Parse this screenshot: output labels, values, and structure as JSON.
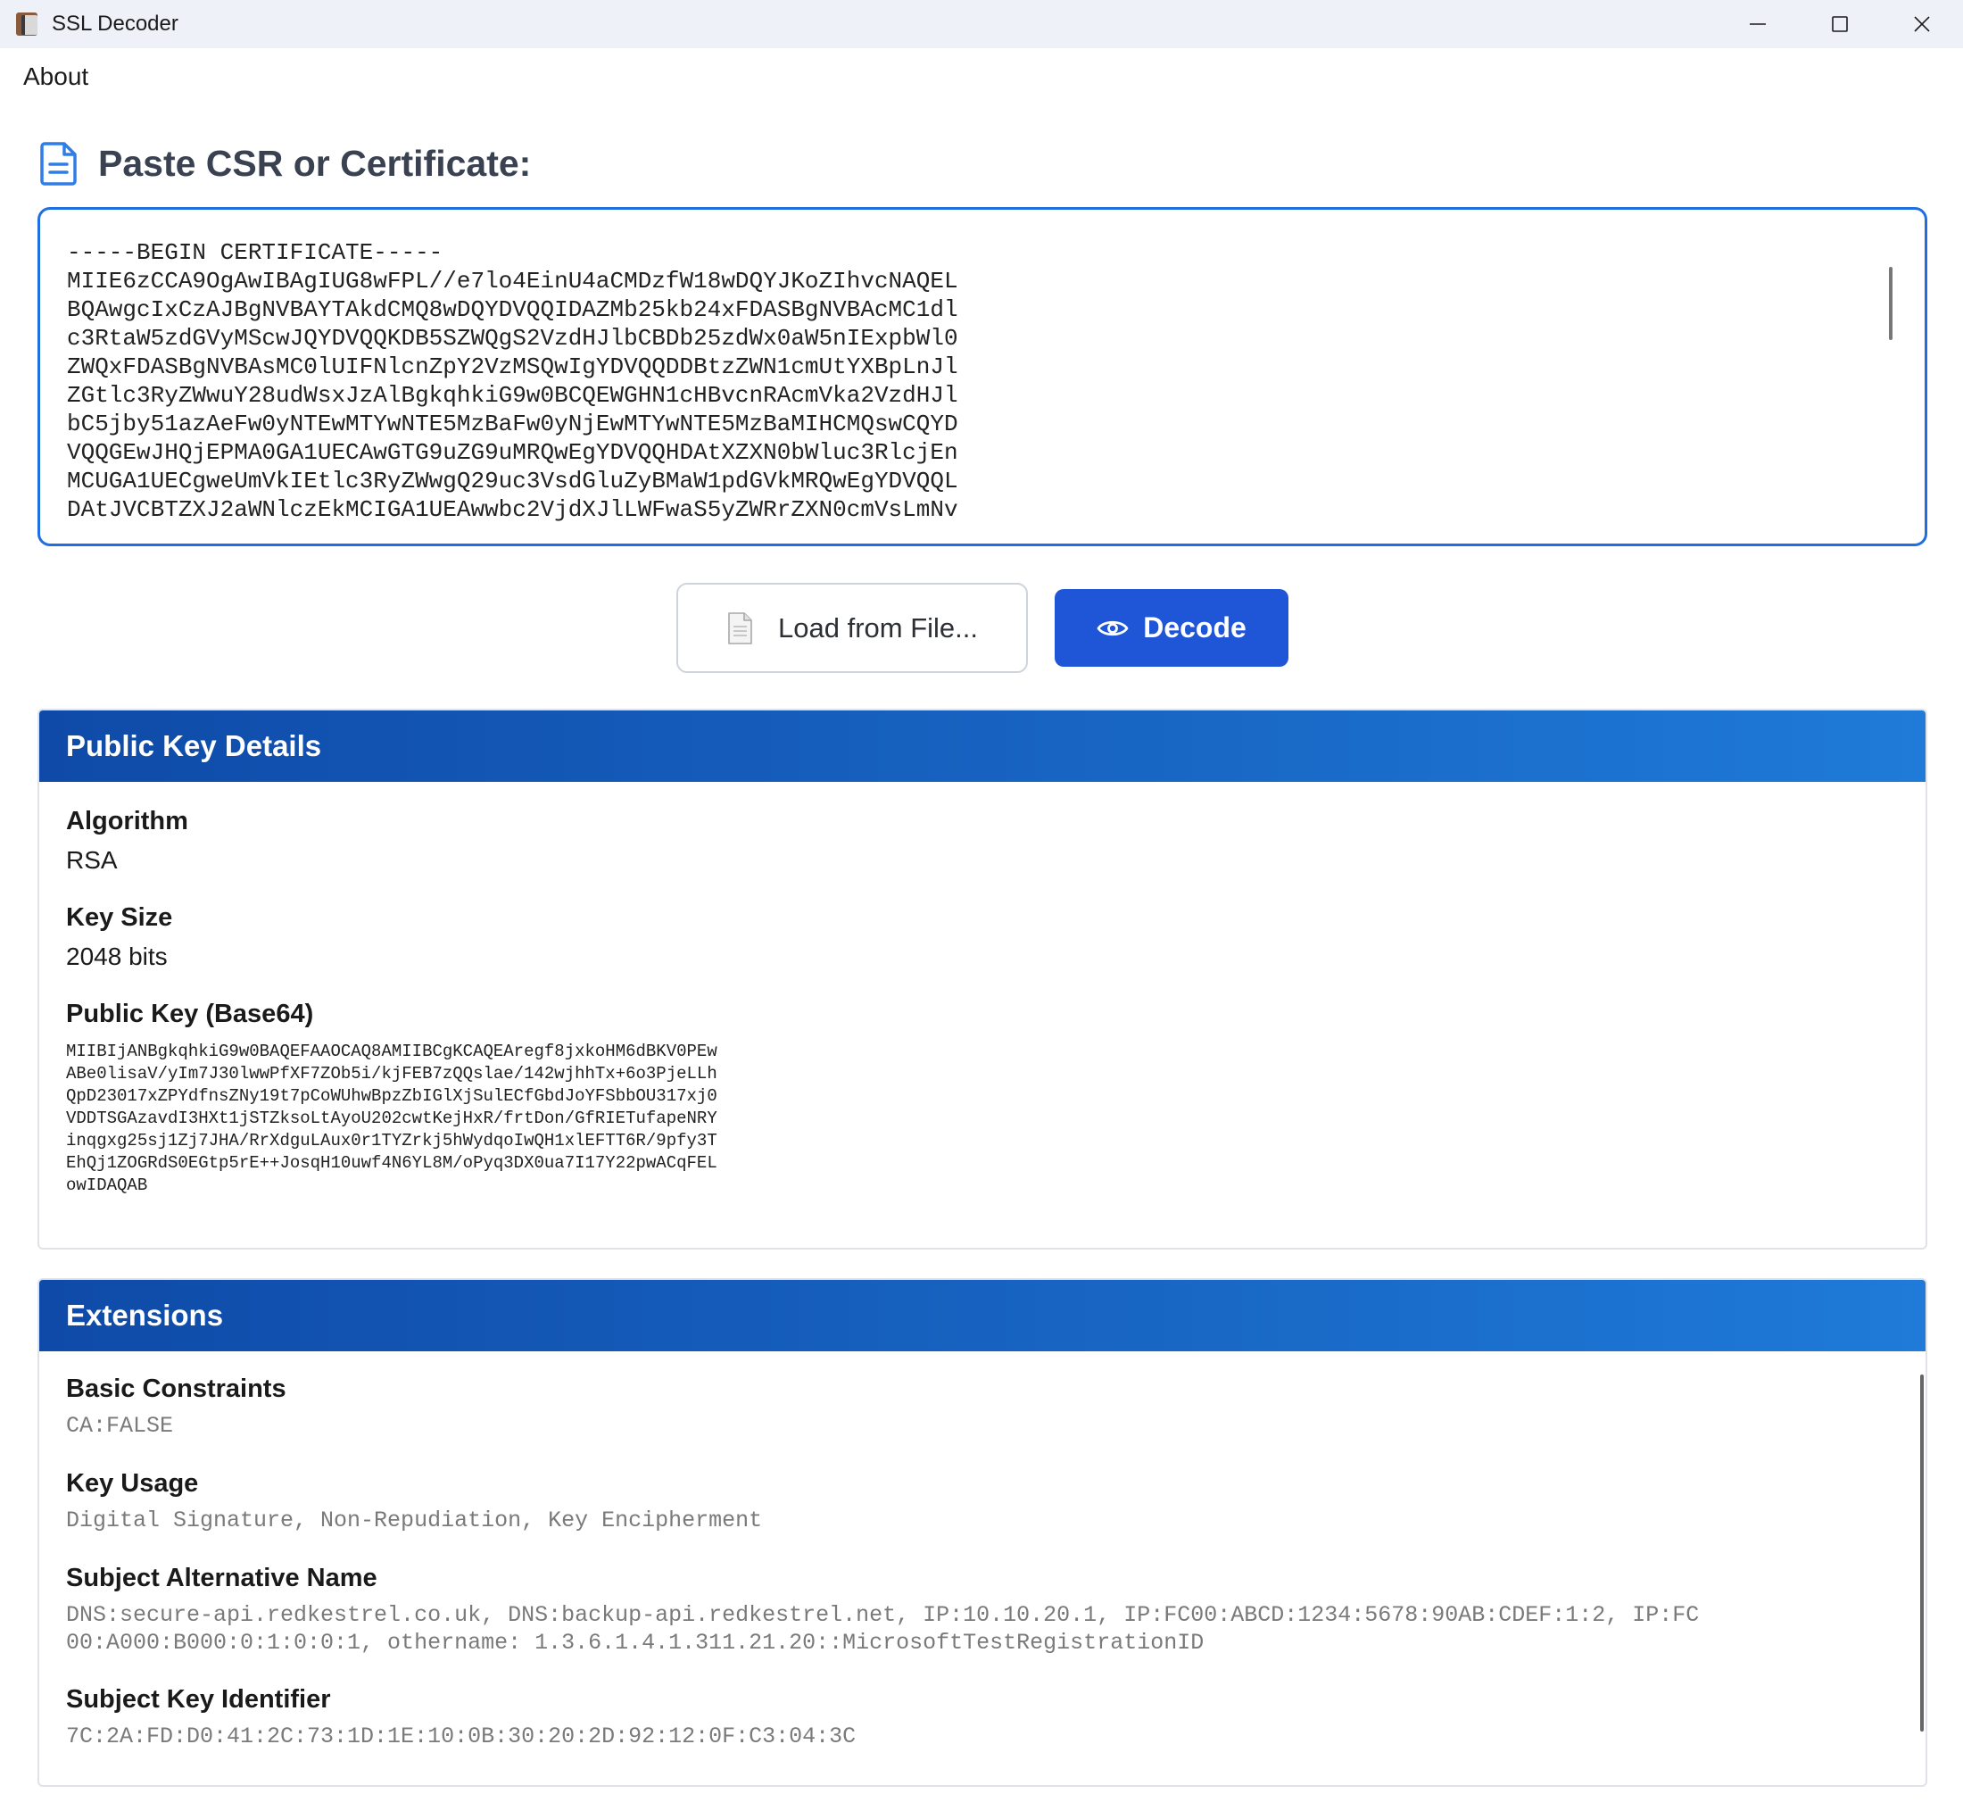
{
  "window": {
    "title": "SSL Decoder",
    "app_icon": "ssl-decoder-app-icon",
    "controls": [
      "minimize-icon",
      "maximize-icon",
      "close-icon"
    ]
  },
  "menu": {
    "about": "About"
  },
  "input_section": {
    "icon": "document-icon",
    "title": "Paste CSR or Certificate:",
    "certificate_text": "-----BEGIN CERTIFICATE-----\nMIIE6zCCA9OgAwIBAgIUG8wFPL//e7lo4EinU4aCMDzfW18wDQYJKoZIhvcNAQEL\nBQAwgcIxCzAJBgNVBAYTAkdCMQ8wDQYDVQQIDAZMb25kb24xFDASBgNVBAcMC1dl\nc3RtaW5zdGVyMScwJQYDVQQKDB5SZWQgS2VzdHJlbCBDb25zdWx0aW5nIExpbWl0\nZWQxFDASBgNVBAsMC0lUIFNlcnZpY2VzMSQwIgYDVQQDDBtzZWN1cmUtYXBpLnJl\nZGtlc3RyZWwuY28udWsxJzAlBgkqhkiG9w0BCQEWGHN1cHBvcnRAcmVka2VzdHJl\nbC5jby51azAeFw0yNTEwMTYwNTE5MzBaFw0yNjEwMTYwNTE5MzBaMIHCMQswCQYD\nVQQGEwJHQjEPMA0GA1UECAwGTG9uZG9uMRQwEgYDVQQHDAtXZXN0bWluc3RlcjEn\nMCUGA1UECgweUmVkIEtlc3RyZWwgQ29uc3VsdGluZyBMaW1pdGVkMRQwEgYDVQQL\nDAtJVCBTZXJ2aWNlczEkMCIGA1UEAwwbc2VjdXJlLWFwaS5yZWRrZXN0cmVsLmNv"
  },
  "buttons": {
    "load_label": "Load from File...",
    "load_icon": "file-icon",
    "decode_label": "Decode",
    "decode_icon": "eye-icon",
    "decode_color": "#1f56d8"
  },
  "public_key": {
    "header": "Public Key Details",
    "algorithm_label": "Algorithm",
    "algorithm_value": "RSA",
    "key_size_label": "Key Size",
    "key_size_value": "2048 bits",
    "base64_label": "Public Key (Base64)",
    "base64_value": "MIIBIjANBgkqhkiG9w0BAQEFAAOCAQ8AMIIBCgKCAQEAregf8jxkoHM6dBKV0PEw\nABe0lisaV/yIm7J30lwwPfXF7ZOb5i/kjFEB7zQQslae/142wjhhTx+6o3PjeLLh\nQpD23017xZPYdfnsZNy19t7pCoWUhwBpzZbIGlXjSulECfGbdJoYFSbbOU317xj0\nVDDTSGAzavdI3HXt1jSTZksoLtAyoU202cwtKejHxR/frtDon/GfRIETufapeNRY\ninqgxg25sj1Zj7JHA/RrXdguLAux0r1TYZrkj5hWydqoIwQH1xlEFTT6R/9pfy3T\nEhQj1ZOGRdS0EGtp5rE++JosqH10uwf4N6YL8M/oPyq3DX0ua7I17Y22pwACqFEL\nowIDAQAB"
  },
  "extensions": {
    "header": "Extensions",
    "basic_constraints_label": "Basic Constraints",
    "basic_constraints_value": "CA:FALSE",
    "key_usage_label": "Key Usage",
    "key_usage_value": "Digital Signature, Non-Repudiation, Key Encipherment",
    "san_label": "Subject Alternative Name",
    "san_value": "DNS:secure-api.redkestrel.co.uk, DNS:backup-api.redkestrel.net, IP:10.10.20.1, IP:FC00:ABCD:1234:5678:90AB:CDEF:1:2, IP:FC\n00:A000:B000:0:1:0:0:1, othername: 1.3.6.1.4.1.311.21.20::MicrosoftTestRegistrationID",
    "ski_label": "Subject Key Identifier",
    "ski_value": "7C:2A:FD:D0:41:2C:73:1D:1E:10:0B:30:20:2D:92:12:0F:C3:04:3C"
  },
  "colors": {
    "accent": "#1f6fe0",
    "header_gradient_start": "#0f4aa8",
    "header_gradient_end": "#1f7ad8"
  }
}
